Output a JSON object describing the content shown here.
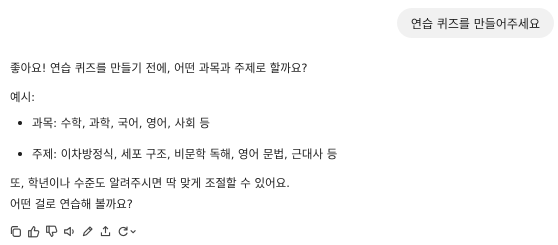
{
  "user_message": "연습 퀴즈를 만들어주세요",
  "assistant": {
    "intro": "좋아요! 연습 퀴즈를 만들기 전에, 어떤 과목과 주제로 할까요?",
    "examples_title": "예시:",
    "examples": [
      "과목: 수학, 과학, 국어, 영어, 사회 등",
      "주제: 이차방정식, 세포 구조, 비문학 독해, 영어 문법, 근대사 등"
    ],
    "closing_line1": "또, 학년이나 수준도 알려주시면 딱 맞게 조절할 수 있어요.",
    "closing_line2": "어떤 걸로 연습해 볼까요?"
  },
  "toolbar": {
    "icons": [
      "copy-icon",
      "thumbs-up-icon",
      "thumbs-down-icon",
      "speaker-icon",
      "edit-icon",
      "share-icon",
      "retry-icon"
    ]
  }
}
